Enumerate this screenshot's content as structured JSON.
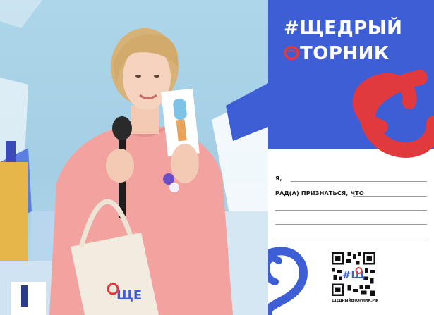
{
  "card": {
    "title_line1": "#ЩЕДРЫЙ",
    "title_line2": "ТОРНИК",
    "field_name_label": "Я,",
    "field_text_label": "РАД(А) ПРИЗНАТЬСЯ, ЧТО",
    "qr_caption": "ЩЕДРЫЙВТОРНИК.РФ"
  },
  "colors": {
    "card_blue": "#3e5ed6",
    "accent_red": "#e03a3e",
    "shirt_pink": "#f2a3a0"
  }
}
